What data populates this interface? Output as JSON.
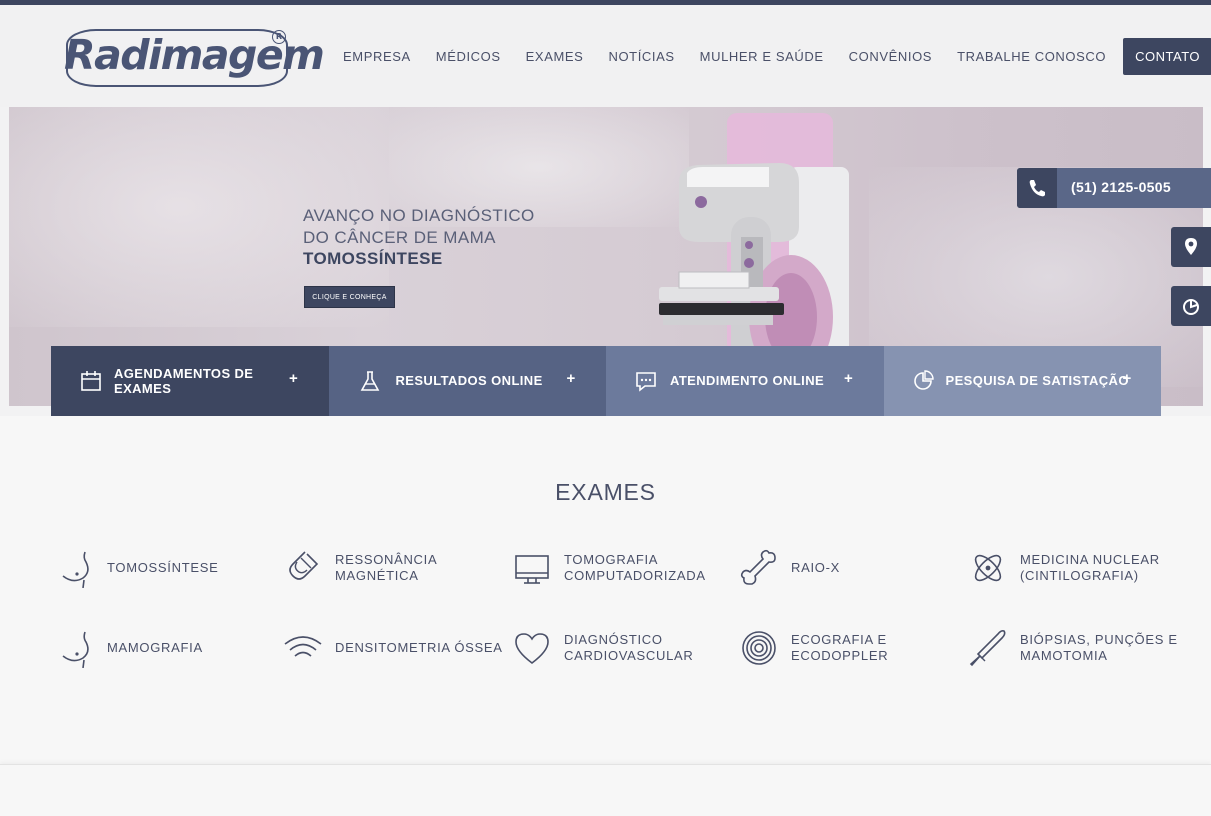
{
  "brand": {
    "logo_text": "Radimagem",
    "registered": "R"
  },
  "nav": {
    "items": [
      "EMPRESA",
      "MÉDICOS",
      "EXAMES",
      "NOTÍCIAS",
      "MULHER E SAÚDE",
      "CONVÊNIOS",
      "TRABALHE CONOSCO"
    ],
    "contact": "CONTATO"
  },
  "hero": {
    "line1": "AVANÇO NO DIAGNÓSTICO",
    "line2": "DO CÂNCER DE MAMA",
    "line3": "TOMOSSÍNTESE",
    "button": "CLIQUE E CONHEÇA"
  },
  "side": {
    "phone": "(51) 2125-0505",
    "icons": [
      "phone-icon",
      "location-pin-icon",
      "clock-icon"
    ]
  },
  "quick_links": [
    {
      "label": "AGENDAMENTOS DE EXAMES",
      "icon": "calendar-icon"
    },
    {
      "label": "RESULTADOS ONLINE",
      "icon": "flask-icon"
    },
    {
      "label": "ATENDIMENTO ONLINE",
      "icon": "chat-icon"
    },
    {
      "label": "PESQUISA DE SATISTAÇÃO",
      "icon": "pie-icon"
    }
  ],
  "plus": "+",
  "exams": {
    "title": "EXAMES",
    "items": [
      {
        "label": "TOMOSSÍNTESE",
        "icon": "breast-icon"
      },
      {
        "label": "RESSONÂNCIA MAGNÉTICA",
        "icon": "magnet-icon"
      },
      {
        "label": "TOMOGRAFIA COMPUTADORIZADA",
        "icon": "monitor-icon"
      },
      {
        "label": "RAIO-X",
        "icon": "bone-icon"
      },
      {
        "label": "MEDICINA NUCLEAR (CINTILOGRAFIA)",
        "icon": "atom-icon"
      },
      {
        "label": "MAMOGRAFIA",
        "icon": "breast-icon"
      },
      {
        "label": "DENSITOMETRIA ÓSSEA",
        "icon": "wifi-waves-icon"
      },
      {
        "label": "DIAGNÓSTICO CARDIOVASCULAR",
        "icon": "heart-icon"
      },
      {
        "label": "ECOGRAFIA E ECODOPPLER",
        "icon": "target-rings-icon"
      },
      {
        "label": "BIÓPSIAS, PUNÇÕES E MAMOTOMIA",
        "icon": "scalpel-icon"
      }
    ]
  },
  "colors": {
    "primary": "#3d4660",
    "accent_2": "#566384",
    "accent_3": "#6c7a9c",
    "accent_4": "#8693b1"
  }
}
